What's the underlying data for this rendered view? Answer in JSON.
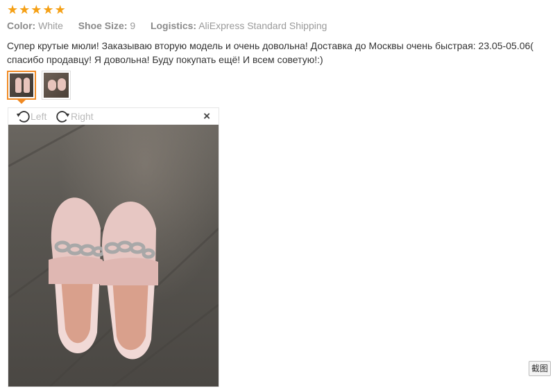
{
  "rating": {
    "stars": 5,
    "max": 5,
    "color": "#f5a015"
  },
  "meta": {
    "color_label": "Color:",
    "color_value": "White",
    "size_label": "Shoe Size:",
    "size_value": "9",
    "logistics_label": "Logistics:",
    "logistics_value": "AliExpress Standard Shipping"
  },
  "review": {
    "line1": "Супер крутые мюли! Заказываю вторую модель и очень довольна! Доставка до Москвы очень быстрая: 23.05-05.06(",
    "line2": "спасибо продавцу! Я довольна! Буду покупать ещё! И всем советую!:)"
  },
  "thumbnails": [
    {
      "active": true
    },
    {
      "active": false
    }
  ],
  "viewer": {
    "rotate_left_label": "Left",
    "rotate_right_label": "Right",
    "close_label": "×",
    "rotate_left_icon": "rotate-ccw-icon",
    "rotate_right_icon": "rotate-cw-icon"
  },
  "screenshot_button_label": "截图"
}
